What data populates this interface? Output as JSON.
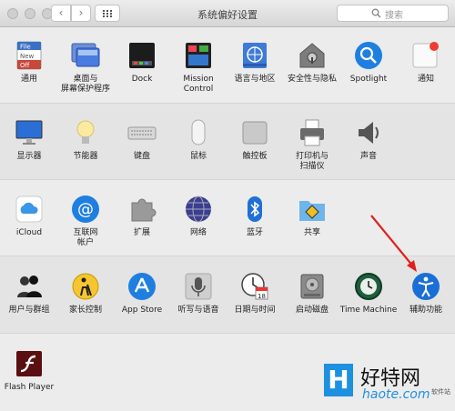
{
  "window": {
    "title": "系统偏好设置",
    "search_placeholder": "搜索"
  },
  "sections": [
    {
      "items": [
        {
          "name": "general",
          "label": "通用"
        },
        {
          "name": "desktop",
          "label": "桌面与\n屏幕保护程序"
        },
        {
          "name": "dock",
          "label": "Dock"
        },
        {
          "name": "mission-control",
          "label": "Mission\nControl"
        },
        {
          "name": "language",
          "label": "语言与地区"
        },
        {
          "name": "security",
          "label": "安全性与隐私"
        },
        {
          "name": "spotlight",
          "label": "Spotlight"
        },
        {
          "name": "notifications",
          "label": "通知"
        }
      ]
    },
    {
      "items": [
        {
          "name": "displays",
          "label": "显示器"
        },
        {
          "name": "energy",
          "label": "节能器"
        },
        {
          "name": "keyboard",
          "label": "键盘"
        },
        {
          "name": "mouse",
          "label": "鼠标"
        },
        {
          "name": "trackpad",
          "label": "触控板"
        },
        {
          "name": "printers",
          "label": "打印机与\n扫描仪"
        },
        {
          "name": "sound",
          "label": "声音"
        }
      ]
    },
    {
      "items": [
        {
          "name": "icloud",
          "label": "iCloud"
        },
        {
          "name": "internet-accounts",
          "label": "互联网\n帐户"
        },
        {
          "name": "extensions",
          "label": "扩展"
        },
        {
          "name": "network",
          "label": "网络"
        },
        {
          "name": "bluetooth",
          "label": "蓝牙"
        },
        {
          "name": "sharing",
          "label": "共享"
        }
      ]
    },
    {
      "items": [
        {
          "name": "users",
          "label": "用户与群组"
        },
        {
          "name": "parental",
          "label": "家长控制"
        },
        {
          "name": "app-store",
          "label": "App Store"
        },
        {
          "name": "dictation",
          "label": "听写与语音"
        },
        {
          "name": "date-time",
          "label": "日期与时间"
        },
        {
          "name": "startup-disk",
          "label": "启动磁盘"
        },
        {
          "name": "time-machine",
          "label": "Time Machine"
        },
        {
          "name": "accessibility",
          "label": "辅助功能"
        }
      ]
    },
    {
      "items": [
        {
          "name": "flash-player",
          "label": "Flash Player"
        }
      ]
    }
  ],
  "icon_texts": {
    "general_file": "File",
    "general_new": "New",
    "general_off": "Off",
    "calendar_day": "18"
  },
  "watermark": {
    "logo": "H",
    "brand": "好特网",
    "url": "haote.com",
    "tag": "软件站"
  },
  "colors": {
    "accent_blue": "#1a6fd6",
    "arrow_red": "#e0201c",
    "notification_red": "#ef3b30"
  }
}
